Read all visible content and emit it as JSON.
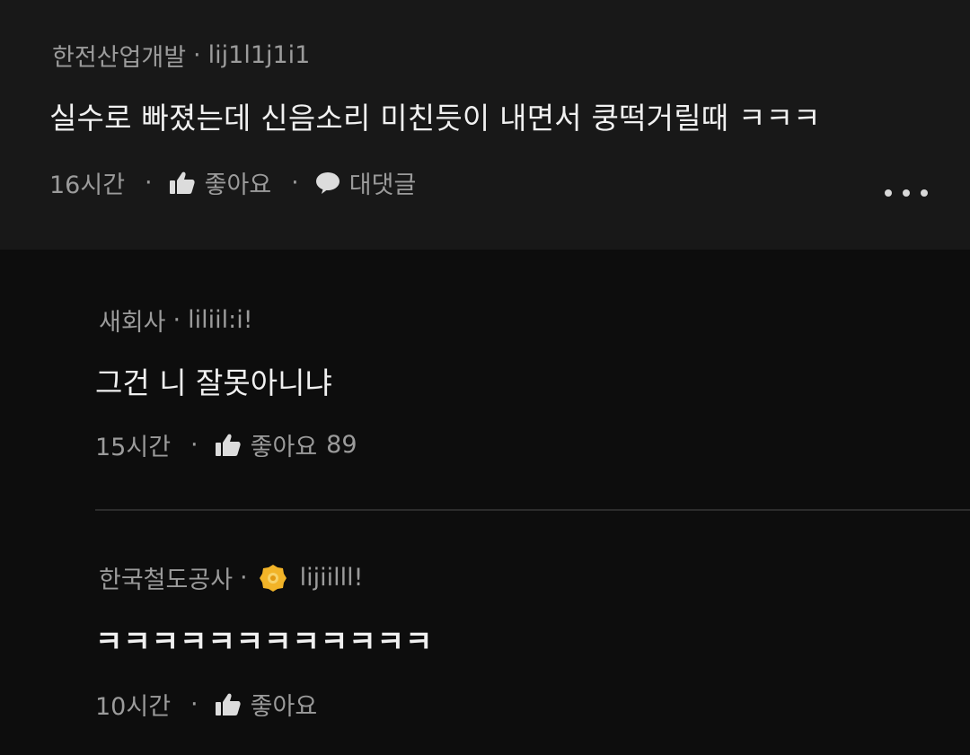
{
  "parent": {
    "author": "한전산업개발",
    "handle": "lij1l1j1i1",
    "separator": "·",
    "body": "실수로 빠졌는데 신음소리 미친듯이 내면서 쿵떡거릴때 ㅋㅋㅋ",
    "time": "16시간",
    "like_label": "좋아요",
    "reply_label": "대댓글",
    "icons": [
      "thumbs-up-icon",
      "speech-bubble-icon",
      "more-options-icon"
    ]
  },
  "replies": [
    {
      "author": "새회사",
      "handle": "liliil:i!",
      "separator": "·",
      "body": "그건 니 잘못아니냐",
      "time": "15시간",
      "like_label": "좋아요",
      "like_count": "89"
    },
    {
      "author": "한국철도공사",
      "handle": "lijiilll!",
      "separator": "·",
      "badge": "gold-badge-icon",
      "body": "ㅋㅋㅋㅋㅋㅋㅋㅋㅋㅋㅋㅋ",
      "time": "10시간",
      "like_label": "좋아요"
    }
  ],
  "colors": {
    "background": "#0d0d0d",
    "parent_background": "#181818",
    "meta_text": "#9b9b9b",
    "body_text": "#f0f0f0",
    "badge": "#f2b428"
  }
}
